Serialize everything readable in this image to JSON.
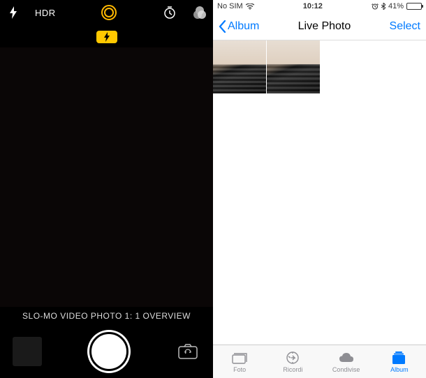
{
  "camera": {
    "top": {
      "hdr_label": "HDR"
    },
    "modes": {
      "text": "SLO-MO VIDEO PHOTO 1: 1 OVERVIEW"
    }
  },
  "photos": {
    "status": {
      "carrier": "No SIM",
      "time": "10:12",
      "battery_pct": "41%"
    },
    "nav": {
      "back": "Album",
      "title": "Live Photo",
      "select": "Select"
    },
    "tabs": {
      "foto": "Foto",
      "ricordi": "Ricordi",
      "condivise": "Condivise",
      "album": "Album"
    }
  }
}
